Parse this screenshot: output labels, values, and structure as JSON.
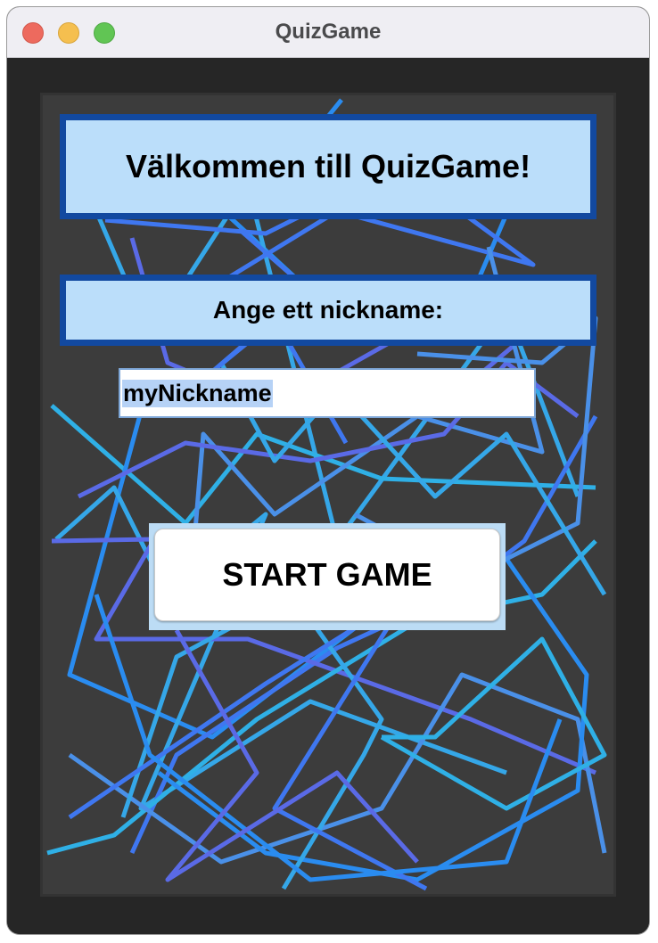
{
  "window": {
    "title": "QuizGame"
  },
  "welcome": {
    "text": "Välkommen till QuizGame!"
  },
  "prompt": {
    "text": "Ange ett nickname:"
  },
  "nickname_field": {
    "value": "myNickname"
  },
  "start_button": {
    "label": "START GAME"
  },
  "colors": {
    "label_fill": "#bbdefa",
    "label_border": "#1249a0",
    "line_palette": [
      "#2a8cf0",
      "#35a7e8",
      "#3f77f0",
      "#5a6ae6",
      "#2fb0e6",
      "#4a90e8"
    ]
  }
}
